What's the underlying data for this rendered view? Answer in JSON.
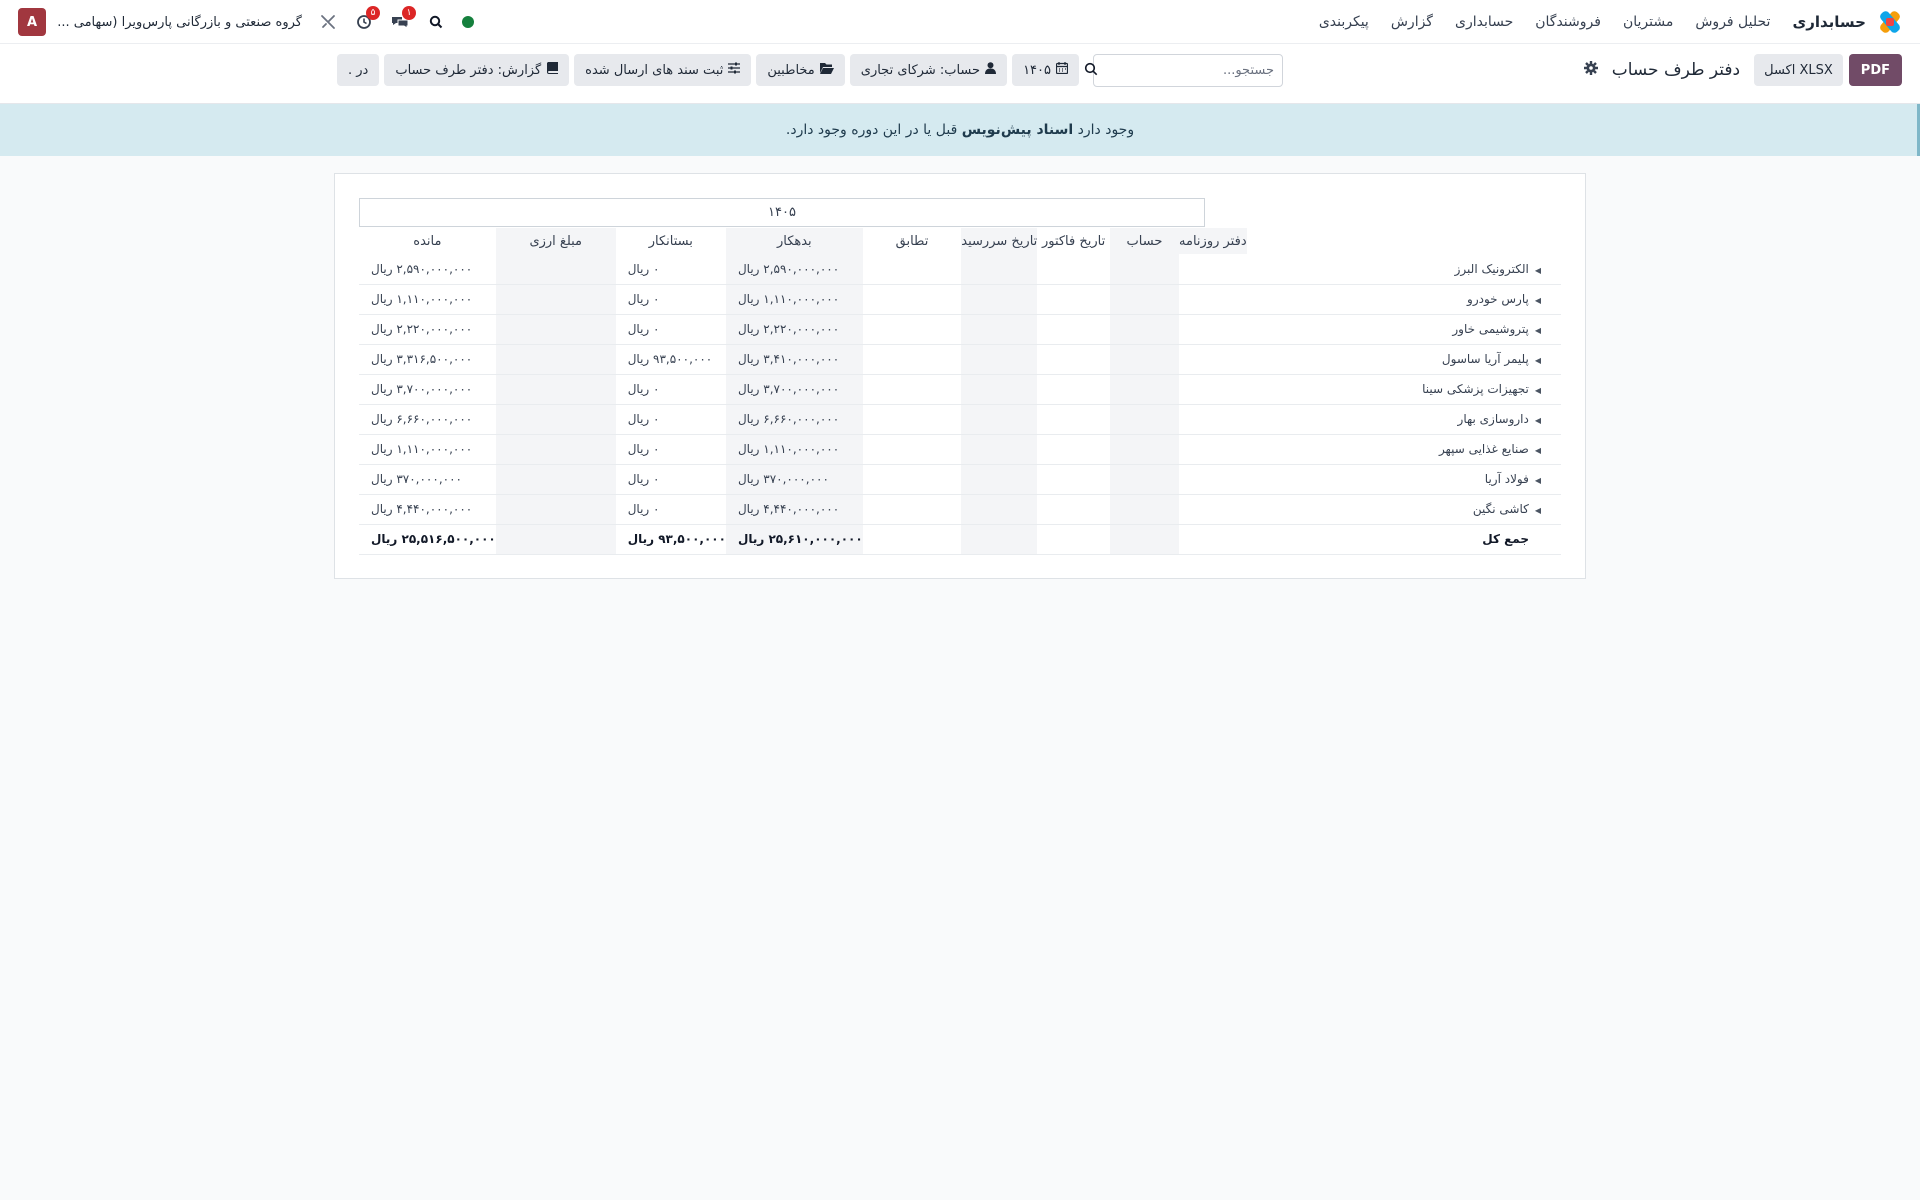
{
  "navbar": {
    "app_name": "حسابداری",
    "menu": [
      "تحلیل فروش",
      "مشتریان",
      "فروشندگان",
      "حسابداری",
      "گزارش",
      "پیکربندی"
    ],
    "company": "گروه صنعتی و بازرگانی پارس‌ویرا (سهامی ...",
    "avatar_letter": "A",
    "activity_badge": "۵",
    "messages_badge": "۱",
    "online_color": "#15803d"
  },
  "control_panel": {
    "pdf_label": "PDF",
    "xlsx_label": "XLSX اکسل",
    "page_title": "دفتر طرف حساب",
    "search_placeholder": "جستجو...",
    "filters": {
      "year": "۱۴۰۵",
      "account": "حساب: شرکای تجاری",
      "partners": "مخاطبین",
      "posted": "ثبت سند های ارسال شده",
      "report": "گزارش: دفتر طرف حساب",
      "more": "در ."
    }
  },
  "alert": {
    "prefix": "وجود دارد ",
    "bold": "اسناد پیش‌نویس",
    "suffix": " قبل یا در این دوره وجود دارد."
  },
  "report": {
    "period": "۱۴۰۵",
    "columns": {
      "journal": "دفتر روزنامه",
      "account": "حساب",
      "invoice_date": "تاریخ فاکتور",
      "due_date": "تاریخ سررسید",
      "matching": "تطابق",
      "debit": "بدهکار",
      "credit": "بستانکار",
      "amount_currency": "مبلغ ارزی",
      "balance": "مانده"
    },
    "rows": [
      {
        "name": "الکترونیک البرز",
        "debit": "۲,۵۹۰,۰۰۰,۰۰۰ ریال",
        "credit": "۰ ریال",
        "balance": "۲,۵۹۰,۰۰۰,۰۰۰ ریال"
      },
      {
        "name": "پارس خودرو",
        "debit": "۱,۱۱۰,۰۰۰,۰۰۰ ریال",
        "credit": "۰ ریال",
        "balance": "۱,۱۱۰,۰۰۰,۰۰۰ ریال"
      },
      {
        "name": "پتروشیمی خاور",
        "debit": "۲,۲۲۰,۰۰۰,۰۰۰ ریال",
        "credit": "۰ ریال",
        "balance": "۲,۲۲۰,۰۰۰,۰۰۰ ریال"
      },
      {
        "name": "پلیمر آریا ساسول",
        "debit": "۳,۴۱۰,۰۰۰,۰۰۰ ریال",
        "credit": "۹۳,۵۰۰,۰۰۰ ریال",
        "balance": "۳,۳۱۶,۵۰۰,۰۰۰ ریال"
      },
      {
        "name": "تجهیزات پزشکی سینا",
        "debit": "۳,۷۰۰,۰۰۰,۰۰۰ ریال",
        "credit": "۰ ریال",
        "balance": "۳,۷۰۰,۰۰۰,۰۰۰ ریال"
      },
      {
        "name": "داروسازی بهار",
        "debit": "۶,۶۶۰,۰۰۰,۰۰۰ ریال",
        "credit": "۰ ریال",
        "balance": "۶,۶۶۰,۰۰۰,۰۰۰ ریال"
      },
      {
        "name": "صنایع غذایی سپهر",
        "debit": "۱,۱۱۰,۰۰۰,۰۰۰ ریال",
        "credit": "۰ ریال",
        "balance": "۱,۱۱۰,۰۰۰,۰۰۰ ریال"
      },
      {
        "name": "فولاد آریا",
        "debit": "۳۷۰,۰۰۰,۰۰۰ ریال",
        "credit": "۰ ریال",
        "balance": "۳۷۰,۰۰۰,۰۰۰ ریال"
      },
      {
        "name": "کاشی نگین",
        "debit": "۴,۴۴۰,۰۰۰,۰۰۰ ریال",
        "credit": "۰ ریال",
        "balance": "۴,۴۴۰,۰۰۰,۰۰۰ ریال"
      }
    ],
    "total": {
      "label": "جمع کل",
      "debit": "۲۵,۶۱۰,۰۰۰,۰۰۰ ریال",
      "credit": "۹۳,۵۰۰,۰۰۰ ریال",
      "balance": "۲۵,۵۱۶,۵۰۰,۰۰۰ ریال"
    }
  }
}
